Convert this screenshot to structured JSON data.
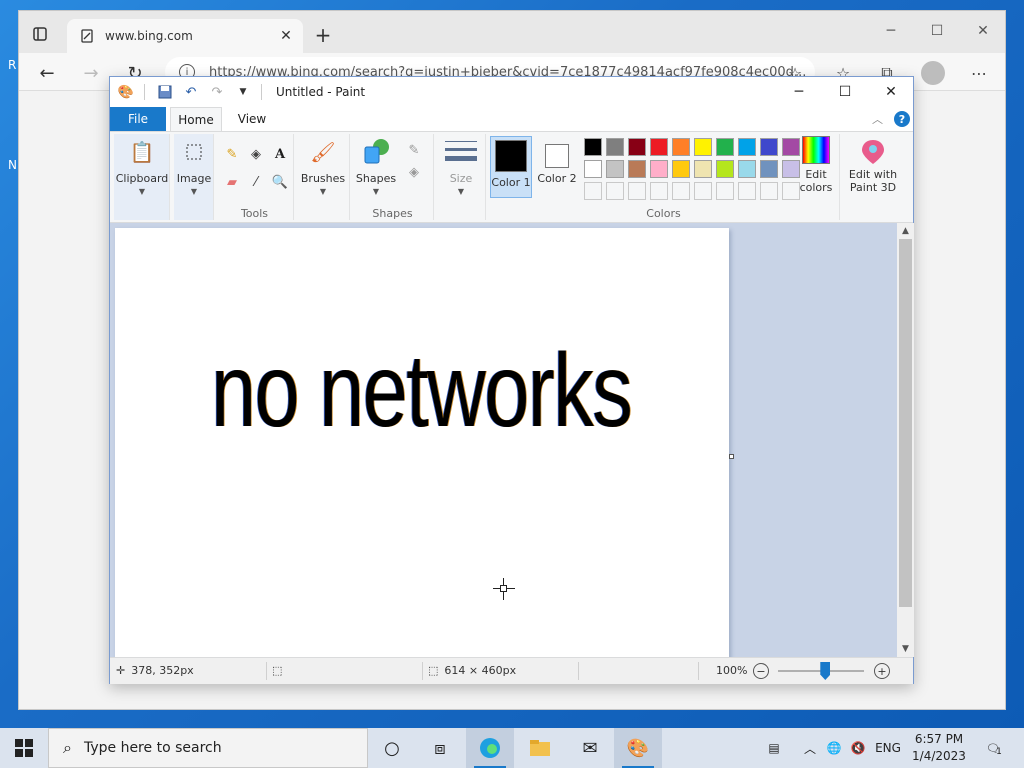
{
  "browser": {
    "tab_title": "www.bing.com",
    "url": "https://www.bing.com/search?q=justin+bieber&cvid=7ce1877c49814acf97fe908c4ec00d...",
    "desktop_edge_letters": [
      "R",
      "N"
    ]
  },
  "paint": {
    "window_title": "Untitled - Paint",
    "tabs": {
      "file": "File",
      "home": "Home",
      "view": "View"
    },
    "help": "?",
    "groups": {
      "clipboard": "Clipboard",
      "image": "Image",
      "tools": "Tools",
      "brushes": "Brushes",
      "shapes_btn": "Shapes",
      "shapes": "Shapes",
      "size": "Size",
      "color1": "Color 1",
      "color2": "Color 2",
      "colors": "Colors",
      "edit_colors": "Edit colors",
      "edit_paint3d": "Edit with Paint 3D"
    },
    "palette_row1": [
      "#000000",
      "#7f7f7f",
      "#880015",
      "#ed1c24",
      "#ff7f27",
      "#fff200",
      "#22b14c",
      "#00a2e8",
      "#3f48cc",
      "#a349a4"
    ],
    "palette_row2": [
      "#ffffff",
      "#c3c3c3",
      "#b97a57",
      "#ffaec9",
      "#ffc90e",
      "#efe4b0",
      "#b5e61d",
      "#99d9ea",
      "#7092be",
      "#c8bfe7"
    ],
    "color1": "#000000",
    "color2": "#ffffff",
    "canvas_text": "no networks",
    "status": {
      "cursor_pos": "378, 352px",
      "canvas_size": "614 × 460px",
      "zoom": "100%",
      "zoom_level": 0.55
    }
  },
  "taskbar": {
    "search_placeholder": "Type here to search",
    "lang": "ENG",
    "time": "6:57 PM",
    "date": "1/4/2023",
    "notification_count": "1"
  }
}
